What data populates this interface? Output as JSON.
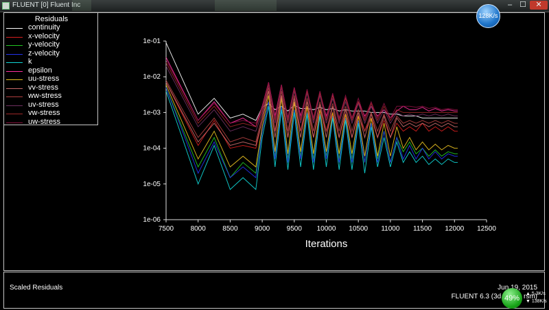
{
  "window": {
    "title": "FLUENT [0] Fluent Inc",
    "controls": {
      "minimize": "–",
      "maximize": "☐",
      "close": "✕"
    }
  },
  "legend": {
    "title": "Residuals",
    "items": [
      {
        "label": "continuity",
        "color": "#ffffff"
      },
      {
        "label": "x-velocity",
        "color": "#d81e1e"
      },
      {
        "label": "y-velocity",
        "color": "#22c722"
      },
      {
        "label": "z-velocity",
        "color": "#2233ee"
      },
      {
        "label": "k",
        "color": "#10d8d8"
      },
      {
        "label": "epsilon",
        "color": "#ff2fa0"
      },
      {
        "label": "uu-stress",
        "color": "#e8c020"
      },
      {
        "label": "vv-stress",
        "color": "#c86a6a"
      },
      {
        "label": "ww-stress",
        "color": "#b04040"
      },
      {
        "label": "uv-stress",
        "color": "#703060"
      },
      {
        "label": "vw-stress",
        "color": "#a02828"
      },
      {
        "label": "uw-stress",
        "color": "#8a1040"
      }
    ]
  },
  "chart_data": {
    "type": "line",
    "xlabel": "Iterations",
    "ylabel": "",
    "xlim": [
      7500,
      12500
    ],
    "ylim": [
      1e-06,
      0.1
    ],
    "y_scale": "log",
    "x_ticks": [
      "7500",
      "8000",
      "8500",
      "9000",
      "9500",
      "10000",
      "10500",
      "11000",
      "11500",
      "12000",
      "12500"
    ],
    "y_ticks": [
      "1e-06",
      "1e-05",
      "1e-04",
      "1e-03",
      "1e-02",
      "1e-01"
    ],
    "x": [
      7500,
      8000,
      8250,
      8500,
      8700,
      8900,
      9000,
      9100,
      9200,
      9300,
      9400,
      9500,
      9600,
      9700,
      9800,
      9900,
      10000,
      10100,
      10200,
      10300,
      10400,
      10500,
      10600,
      10700,
      10800,
      10900,
      11000,
      11100,
      11200,
      11300,
      11400,
      11500,
      11600,
      11700,
      11800,
      11900,
      12000,
      12050
    ],
    "series": [
      {
        "name": "continuity",
        "values": [
          0.09,
          0.0009,
          0.0025,
          0.0007,
          0.0009,
          0.0006,
          0.0014,
          0.0018,
          0.0012,
          0.0015,
          0.0011,
          0.0016,
          0.0013,
          0.0013,
          0.0012,
          0.0014,
          0.0012,
          0.0013,
          0.0011,
          0.0012,
          0.0011,
          0.0011,
          0.0011,
          0.001,
          0.001,
          0.001,
          0.0009,
          0.0009,
          0.0008,
          0.0008,
          0.0008,
          0.0007,
          0.0007,
          0.0007,
          0.0007,
          0.0007,
          0.0007,
          0.0007
        ]
      },
      {
        "name": "x-velocity",
        "values": [
          0.007,
          0.00012,
          0.0006,
          0.0001,
          0.00012,
          0.0001,
          0.0006,
          0.004,
          0.0003,
          0.003,
          0.0002,
          0.002,
          0.0003,
          0.0015,
          0.0002,
          0.0012,
          0.0003,
          0.001,
          0.0002,
          0.0009,
          0.0002,
          0.0008,
          0.0003,
          0.0007,
          0.0002,
          0.0006,
          0.0002,
          0.0005,
          0.0003,
          0.0004,
          0.0003,
          0.0005,
          0.0003,
          0.0004,
          0.0003,
          0.0004,
          0.0003,
          0.0003
        ]
      },
      {
        "name": "y-velocity",
        "values": [
          0.005,
          3e-05,
          0.0002,
          1.5e-05,
          4e-05,
          2e-05,
          0.0003,
          0.002,
          6e-05,
          0.0015,
          5e-05,
          0.0012,
          6e-05,
          0.001,
          5e-05,
          0.0009,
          6e-05,
          0.0008,
          5e-05,
          0.0007,
          5e-05,
          0.0006,
          4e-05,
          0.0005,
          5e-05,
          0.0003,
          4e-05,
          0.0002,
          8e-05,
          0.00015,
          7e-05,
          0.0001,
          6e-05,
          9e-05,
          6e-05,
          8e-05,
          7e-05,
          7e-05
        ]
      },
      {
        "name": "z-velocity",
        "values": [
          0.005,
          2e-05,
          0.00015,
          1.5e-05,
          3e-05,
          1.5e-05,
          0.0003,
          0.002,
          5e-05,
          0.0015,
          4e-05,
          0.0012,
          5e-05,
          0.001,
          4e-05,
          0.0009,
          5e-05,
          0.0008,
          4e-05,
          0.0007,
          4e-05,
          0.0006,
          4e-05,
          0.0005,
          4e-05,
          0.0003,
          4e-05,
          0.0002,
          5e-05,
          0.00012,
          5e-05,
          0.0001,
          5e-05,
          8e-05,
          5e-05,
          7e-05,
          6e-05,
          6e-05
        ]
      },
      {
        "name": "k",
        "values": [
          0.004,
          1e-05,
          0.00012,
          7e-06,
          1.5e-05,
          7e-06,
          0.0002,
          0.0015,
          3e-05,
          0.0012,
          2.5e-05,
          0.001,
          3e-05,
          0.0009,
          2.5e-05,
          0.0008,
          3e-05,
          0.0007,
          2.5e-05,
          0.0006,
          2.5e-05,
          0.0005,
          2e-05,
          0.0004,
          3e-05,
          0.0002,
          3e-05,
          0.00015,
          4e-05,
          8e-05,
          4e-05,
          6e-05,
          3.5e-05,
          5e-05,
          3.5e-05,
          5e-05,
          4e-05,
          4e-05
        ]
      },
      {
        "name": "epsilon",
        "values": [
          0.035,
          0.0006,
          0.002,
          0.0005,
          0.0007,
          0.0004,
          0.0015,
          0.007,
          0.0008,
          0.006,
          0.0007,
          0.005,
          0.0008,
          0.004,
          0.0007,
          0.0035,
          0.0008,
          0.003,
          0.0007,
          0.0025,
          0.0007,
          0.002,
          0.0008,
          0.0015,
          0.0008,
          0.0012,
          0.0007,
          0.0011,
          0.0015,
          0.0012,
          0.0012,
          0.0014,
          0.0011,
          0.0013,
          0.0011,
          0.0012,
          0.0011,
          0.0011
        ]
      },
      {
        "name": "uu-stress",
        "values": [
          0.006,
          5e-05,
          0.0003,
          3e-05,
          6e-05,
          3e-05,
          0.0004,
          0.003,
          8e-05,
          0.0025,
          7e-05,
          0.002,
          8e-05,
          0.0015,
          7e-05,
          0.0012,
          8e-05,
          0.001,
          7e-05,
          0.0009,
          7e-05,
          0.0008,
          6e-05,
          0.0007,
          6e-05,
          0.0005,
          6e-05,
          0.0004,
          0.0001,
          0.0002,
          9e-05,
          0.00015,
          9e-05,
          0.00013,
          9e-05,
          0.00012,
          0.0001,
          0.0001
        ]
      },
      {
        "name": "vv-stress",
        "values": [
          0.007,
          0.00015,
          0.0005,
          0.00012,
          0.00015,
          0.00012,
          0.0006,
          0.004,
          0.0002,
          0.003,
          0.0002,
          0.0025,
          0.0002,
          0.002,
          0.0002,
          0.0017,
          0.0002,
          0.0015,
          0.0002,
          0.0012,
          0.0002,
          0.001,
          0.0002,
          0.0009,
          0.0002,
          0.0008,
          0.0002,
          0.0007,
          0.0004,
          0.0005,
          0.0004,
          0.0005,
          0.0004,
          0.0005,
          0.0004,
          0.0005,
          0.0004,
          0.0004
        ]
      },
      {
        "name": "ww-stress",
        "values": [
          0.008,
          0.0002,
          0.0007,
          0.00015,
          0.0002,
          0.00015,
          0.0008,
          0.005,
          0.0003,
          0.004,
          0.0003,
          0.003,
          0.0003,
          0.0025,
          0.0003,
          0.002,
          0.0003,
          0.0018,
          0.0003,
          0.0015,
          0.0003,
          0.0012,
          0.0003,
          0.001,
          0.0003,
          0.0009,
          0.0003,
          0.0008,
          0.0005,
          0.0006,
          0.0005,
          0.0006,
          0.0005,
          0.0006,
          0.0005,
          0.0006,
          0.0005,
          0.0005
        ]
      },
      {
        "name": "uv-stress",
        "values": [
          0.02,
          0.0004,
          0.0012,
          0.0003,
          0.0004,
          0.0003,
          0.001,
          0.006,
          0.0005,
          0.005,
          0.0005,
          0.004,
          0.0005,
          0.0035,
          0.0005,
          0.003,
          0.0005,
          0.0025,
          0.0005,
          0.002,
          0.0005,
          0.0018,
          0.0005,
          0.0015,
          0.0005,
          0.0012,
          0.0005,
          0.001,
          0.0008,
          0.0009,
          0.0008,
          0.0009,
          0.0008,
          0.0009,
          0.0008,
          0.0009,
          0.0008,
          0.0008
        ]
      },
      {
        "name": "vw-stress",
        "values": [
          0.025,
          0.0005,
          0.0015,
          0.0004,
          0.0005,
          0.0004,
          0.0012,
          0.0065,
          0.0006,
          0.0055,
          0.0006,
          0.0045,
          0.0006,
          0.004,
          0.0006,
          0.0035,
          0.0006,
          0.003,
          0.0006,
          0.0025,
          0.0006,
          0.002,
          0.0006,
          0.0018,
          0.0006,
          0.0015,
          0.0006,
          0.0012,
          0.001,
          0.001,
          0.001,
          0.001,
          0.001,
          0.001,
          0.001,
          0.001,
          0.001,
          0.001
        ]
      },
      {
        "name": "uw-stress",
        "values": [
          0.03,
          0.0006,
          0.0018,
          0.0005,
          0.0006,
          0.0005,
          0.0014,
          0.007,
          0.0007,
          0.006,
          0.0007,
          0.005,
          0.0007,
          0.0045,
          0.0007,
          0.004,
          0.0007,
          0.0035,
          0.0007,
          0.003,
          0.0007,
          0.0025,
          0.0007,
          0.002,
          0.0007,
          0.0018,
          0.0007,
          0.0015,
          0.0015,
          0.0015,
          0.0014,
          0.0015,
          0.0013,
          0.0014,
          0.0012,
          0.0013,
          0.0012,
          0.0012
        ]
      }
    ],
    "grid": false,
    "legend_position": "top-left"
  },
  "status": {
    "left_text": "Scaled Residuals",
    "date": "Jun 19, 2015",
    "product": "FLUENT 6.3 (3d, pbns, rsm)"
  },
  "overlay": {
    "net_speed": "128K/s",
    "cpu": "49%",
    "upload": "5.3K/s",
    "download": "138K/s"
  }
}
